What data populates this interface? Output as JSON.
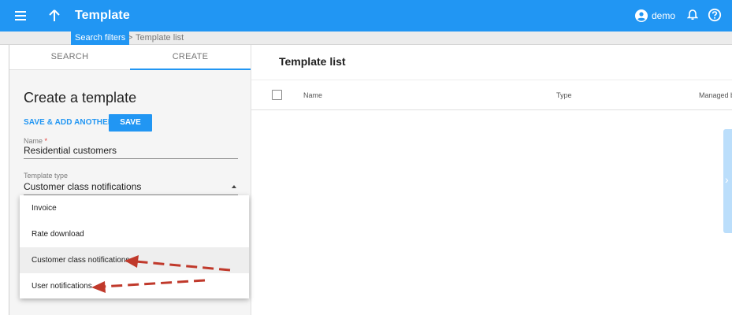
{
  "header": {
    "title": "Template",
    "menu_icon": "menu-icon",
    "up_icon": "arrow-up-icon",
    "user_name": "demo",
    "user_icon": "account-icon",
    "notifications_icon": "bell-icon",
    "help_icon": "help-icon",
    "accent_color": "#2196f3"
  },
  "breadcrumb": {
    "items": [
      "Search filters",
      "Template list"
    ],
    "separator": ">"
  },
  "tabs": [
    {
      "label": "SEARCH",
      "active": false
    },
    {
      "label": "CREATE",
      "active": true
    }
  ],
  "form": {
    "title": "Create a template",
    "save_another_label": "SAVE & ADD ANOTHER",
    "save_label": "SAVE",
    "name_label": "Name",
    "name_required_marker": "*",
    "name_value": "Residential customers",
    "type_label": "Template type",
    "type_value": "Customer class notifications",
    "type_options": [
      "Invoice",
      "Rate download",
      "Customer class notifications",
      "User notifications"
    ],
    "highlighted_option": "Customer class notifications"
  },
  "main": {
    "title": "Template list",
    "columns": [
      "Name",
      "Type",
      "Managed b"
    ]
  },
  "annotations": {
    "arrow_color": "#c0392b",
    "arrow_targets": [
      "Customer class notifications",
      "User notifications"
    ]
  }
}
